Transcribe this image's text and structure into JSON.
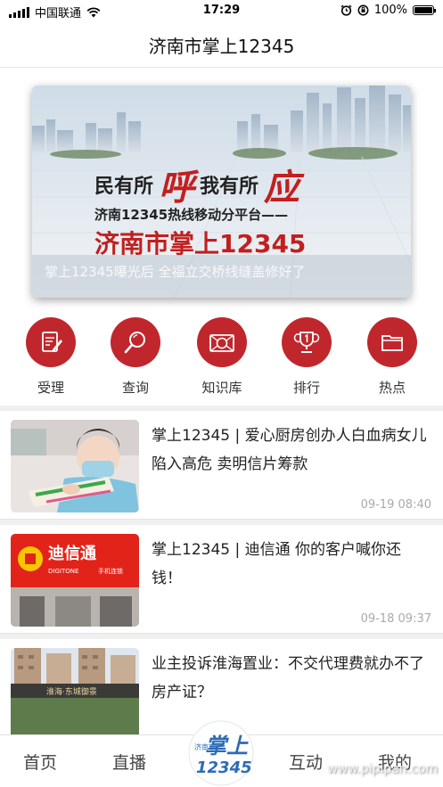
{
  "status_bar": {
    "carrier": "中国联通",
    "time": "17:29",
    "battery": "100%",
    "battery_level": 1.0
  },
  "nav": {
    "title": "济南市掌上12345"
  },
  "banner": {
    "slogan_a": "民有所",
    "slogan_a_big": "呼",
    "slogan_b": "我有所",
    "slogan_b_big": "应",
    "subtitle": "济南12345热线移动分平台——",
    "brand": "济南市掌上12345",
    "marquee": "掌上12345曝光后 全福立交桥线缝盖修好了"
  },
  "menu": {
    "items": [
      {
        "label": "受理",
        "icon": "document-edit-icon"
      },
      {
        "label": "查询",
        "icon": "search-icon"
      },
      {
        "label": "知识库",
        "icon": "knowledge-icon"
      },
      {
        "label": "排行",
        "icon": "trophy-icon"
      },
      {
        "label": "热点",
        "icon": "folder-icon"
      }
    ]
  },
  "news": [
    {
      "title": "掌上12345 | 爱心厨房创办人白血病女儿陷入高危 卖明信片筹款",
      "date": "09-19 08:40"
    },
    {
      "title": "掌上12345 | 迪信通 你的客户喊你还钱！",
      "date": "09-18 09:37",
      "thumb_sign": "迪信通",
      "thumb_sign_en": "DIGITONE",
      "thumb_sign_sub": "手机连锁"
    },
    {
      "title": "业主投诉淮海置业：不交代理费就办不了房产证？",
      "date": "",
      "thumb_sign": "淮海·东城御景"
    }
  ],
  "tabs": {
    "home": "首页",
    "live": "直播",
    "center_logo_small": "济南市",
    "center_logo_big": "掌上",
    "center_logo_num": "12345",
    "interact": "互动",
    "mine": "我的"
  },
  "watermark": "www.pipipan.com",
  "colors": {
    "accent": "#c0272d",
    "brand_red": "#c21f1f",
    "date_gray": "#aaaaaa"
  }
}
